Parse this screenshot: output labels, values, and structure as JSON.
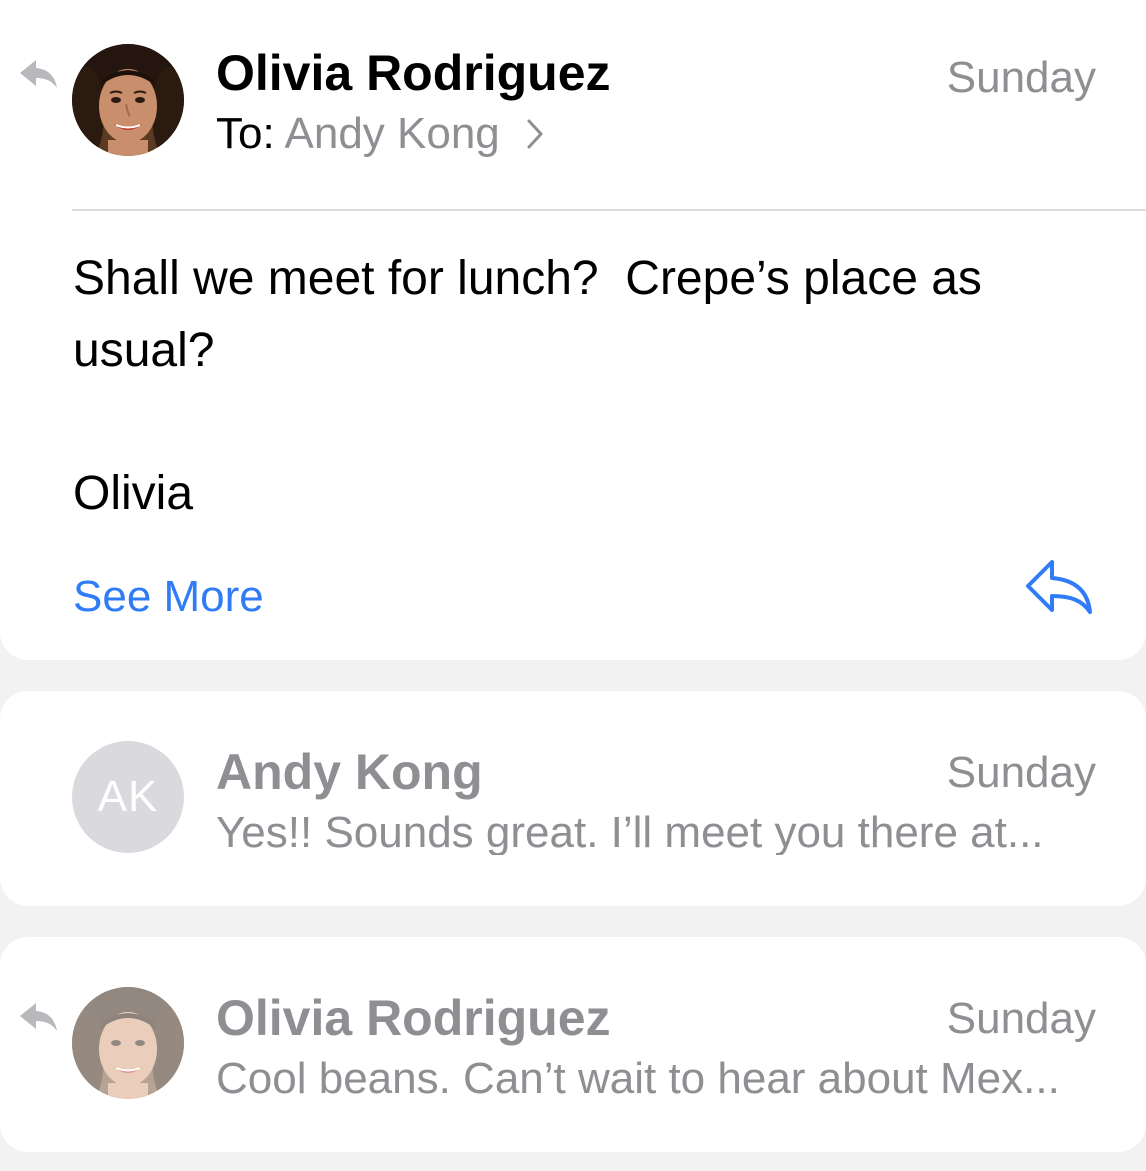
{
  "thread": {
    "expanded_message": {
      "sender": "Olivia Rodriguez",
      "date": "Sunday",
      "to_label": "To:",
      "to_name": "Andy Kong",
      "body": "Shall we meet for lunch?  Crepe’s place as usual?",
      "signature": "Olivia",
      "see_more_label": "See More",
      "has_replied": true
    },
    "collapsed_messages": [
      {
        "sender": "Andy Kong",
        "initials": "AK",
        "date": "Sunday",
        "snippet": "Yes!! Sounds great. I’ll meet you there at...",
        "has_replied": false
      },
      {
        "sender": "Olivia Rodriguez",
        "date": "Sunday",
        "snippet": "Cool beans. Can’t wait to hear about Mex...",
        "has_replied": true
      }
    ]
  },
  "icons": {
    "reply_indicator": "reply-arrow-icon",
    "reply_button": "reply-icon",
    "chevron": "chevron-right-icon"
  },
  "colors": {
    "accent": "#2f7cf6",
    "muted_text": "#8e8e93",
    "background": "#f2f2f2",
    "card": "#ffffff",
    "initials_avatar": "#d9d9de"
  }
}
